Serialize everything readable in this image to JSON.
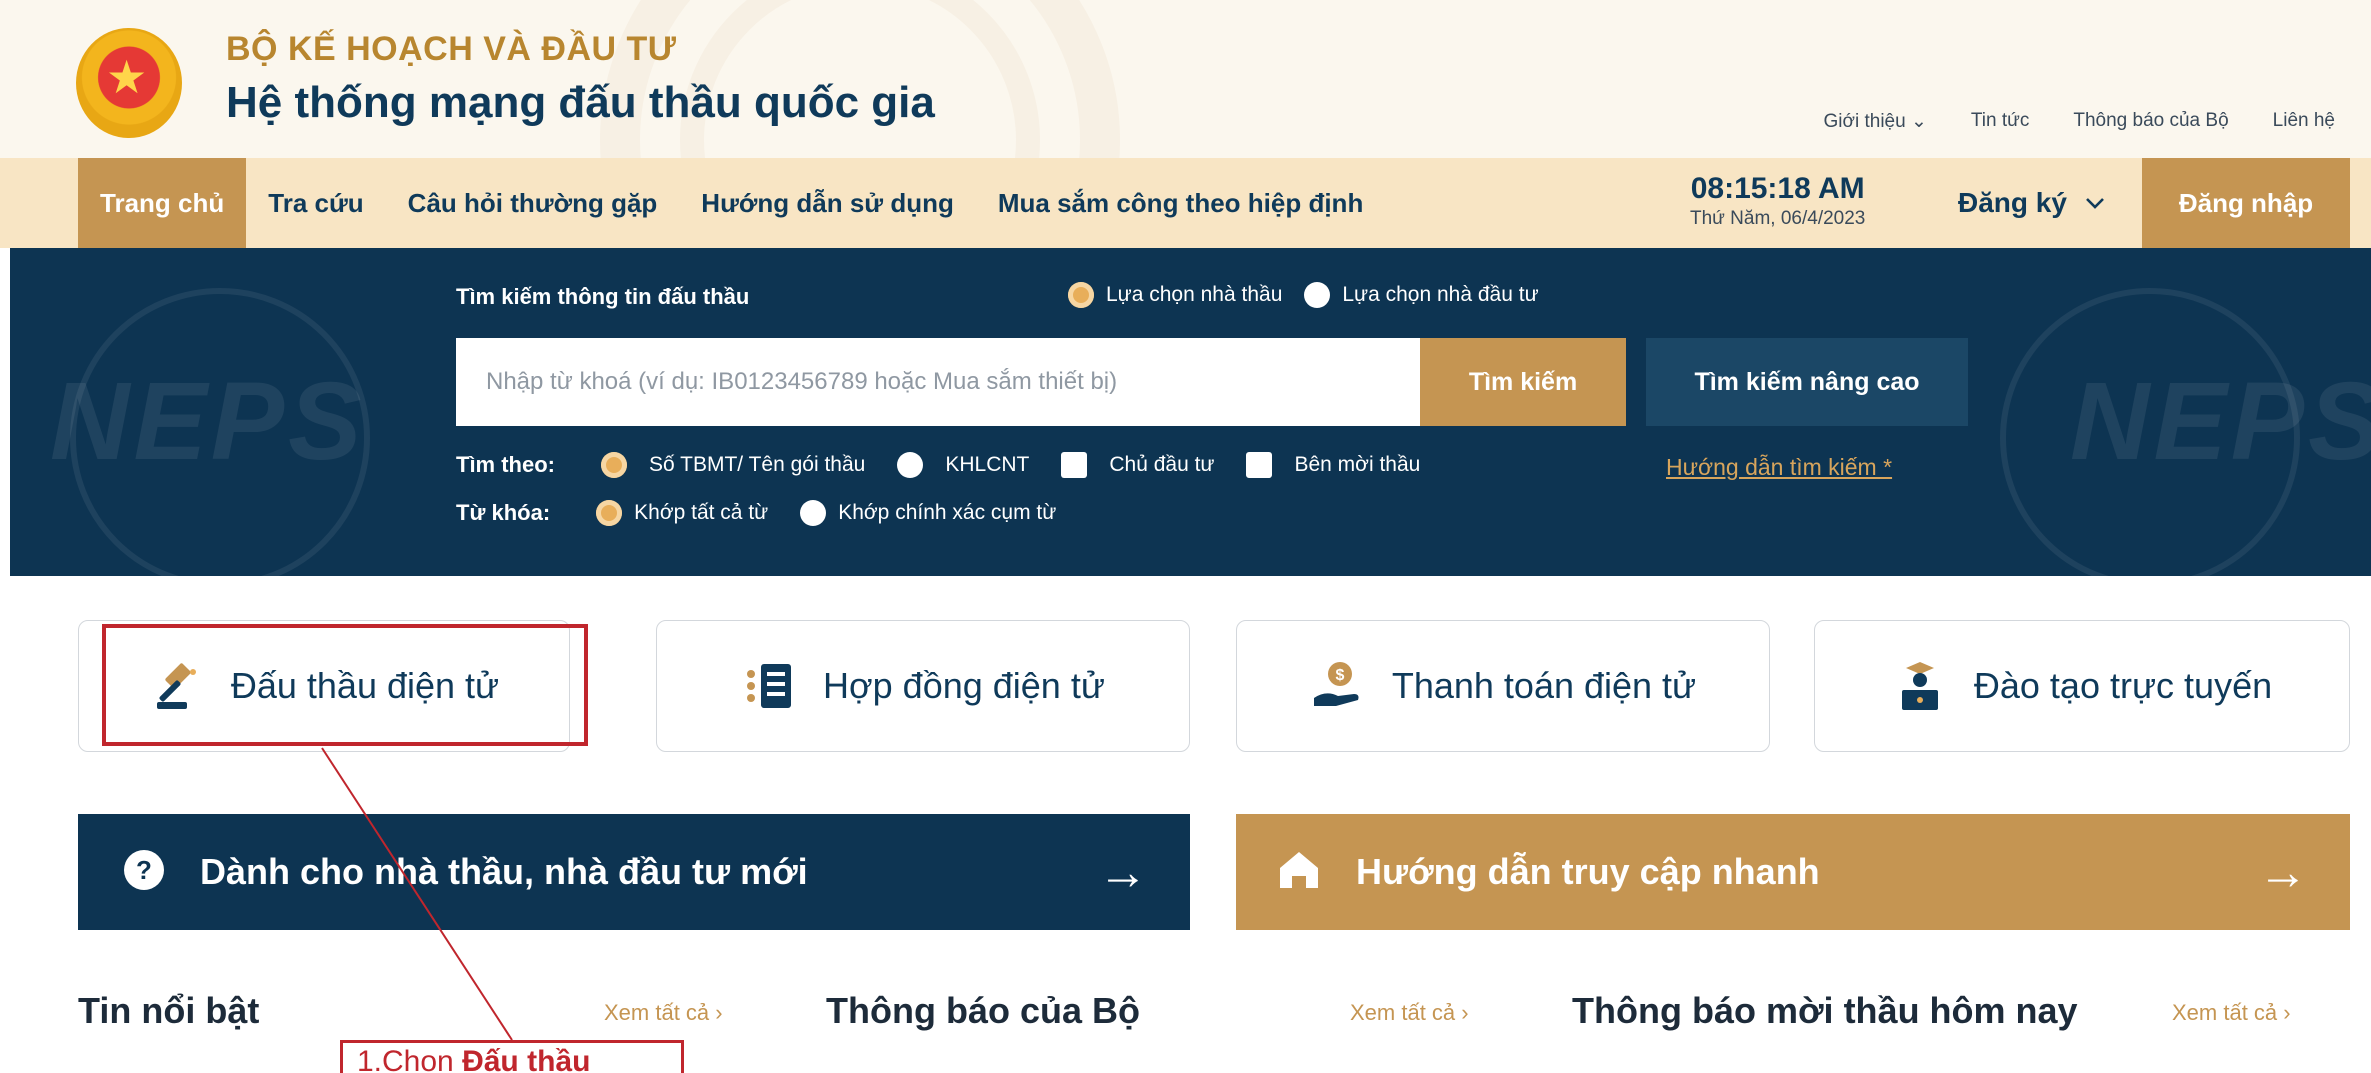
{
  "header": {
    "org_name": "BỘ KẾ HOẠCH VÀ ĐẦU TƯ",
    "system_name": "Hệ thống mạng đấu thầu quốc gia",
    "top_links": [
      "Giới thiệu ⌄",
      "Tin tức",
      "Thông báo của Bộ",
      "Liên hệ"
    ]
  },
  "nav": {
    "items": [
      "Trang chủ",
      "Tra cứu",
      "Câu hỏi thường gặp",
      "Hướng dẫn sử dụng",
      "Mua sắm công theo hiệp định"
    ],
    "active_index": 0,
    "time": "08:15:18 AM",
    "date": "Thứ Năm, 06/4/2023",
    "register_label": "Đăng ký",
    "login_label": "Đăng nhập"
  },
  "search": {
    "title": "Tìm kiếm thông tin đấu thầu",
    "mode_options": [
      {
        "label": "Lựa chọn nhà thầu",
        "selected": true
      },
      {
        "label": "Lựa chọn nhà đầu tư",
        "selected": false
      }
    ],
    "placeholder": "Nhập từ khoá (ví dụ: IB0123456789 hoặc Mua sắm thiết bị)",
    "search_button": "Tìm kiếm",
    "advanced_button": "Tìm kiếm nâng cao",
    "search_by_label": "Tìm theo:",
    "search_by_options": [
      {
        "label": "Số TBMT/ Tên gói thầu",
        "type": "radio",
        "selected": true
      },
      {
        "label": "KHLCNT",
        "type": "radio",
        "selected": false
      },
      {
        "label": "Chủ đầu tư",
        "type": "checkbox",
        "selected": false
      },
      {
        "label": "Bên mời thầu",
        "type": "checkbox",
        "selected": false
      }
    ],
    "guide_link": "Hướng dẫn tìm kiếm *",
    "keyword_label": "Từ khóa:",
    "keyword_options": [
      {
        "label": "Khớp tất cả từ",
        "selected": true
      },
      {
        "label": "Khớp chính xác cụm từ",
        "selected": false
      }
    ],
    "watermark": "NEPS"
  },
  "services": [
    {
      "label": "Đấu thầu điện tử",
      "icon": "gavel-icon"
    },
    {
      "label": "Hợp đồng điện tử",
      "icon": "contract-list-icon"
    },
    {
      "label": "Thanh toán điện tử",
      "icon": "payment-hand-icon"
    },
    {
      "label": "Đào tạo trực tuyến",
      "icon": "training-podium-icon"
    }
  ],
  "banners": {
    "new_bidders": "Dành cho nhà thầu, nhà đầu tư mới",
    "quick_access": "Hướng dẫn truy cập nhanh"
  },
  "sections": {
    "highlights": "Tin nổi bật",
    "ministry_notices": "Thông báo của Bộ",
    "today_invitations": "Thông báo mời thầu hôm nay",
    "see_all": "Xem tất cả  ›"
  },
  "annotation": {
    "prefix": "1.Chọn ",
    "bold": "Đấu thầu"
  },
  "colors": {
    "navy": "#0d3452",
    "gold": "#c59552",
    "nav_bg": "#f8e5c4",
    "highlight_red": "#c0262d"
  }
}
